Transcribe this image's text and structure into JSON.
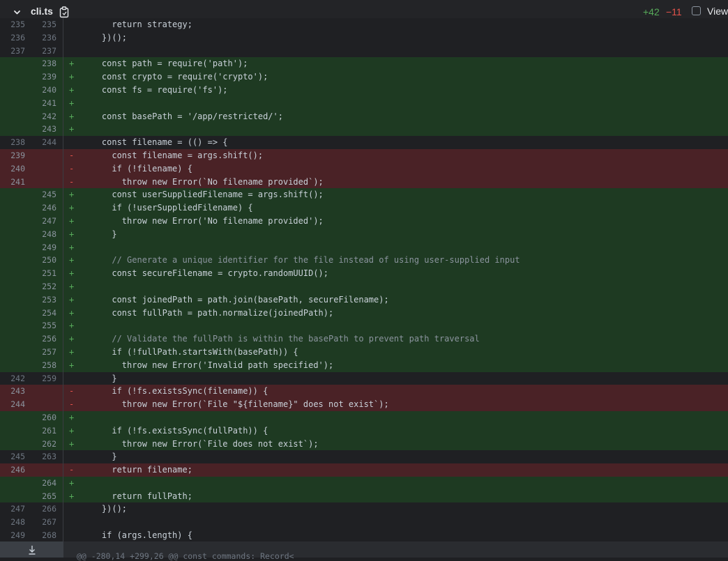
{
  "header": {
    "filename": "cli.ts",
    "additions": "+42",
    "deletions": "−11",
    "view_label": "View",
    "icons": [
      "chevron-down-icon",
      "copy-icon",
      "checkbox"
    ]
  },
  "colors": {
    "added_bg": "#1e3a22",
    "removed_bg": "#4a2226",
    "added_text": "#57ab5a",
    "removed_text": "#e5534b"
  },
  "lines": [
    {
      "type": "ctx",
      "old": "235",
      "new": "235",
      "code": "      return strategy;"
    },
    {
      "type": "ctx",
      "old": "236",
      "new": "236",
      "code": "    })();"
    },
    {
      "type": "ctx",
      "old": "237",
      "new": "237",
      "code": ""
    },
    {
      "type": "add",
      "old": "",
      "new": "238",
      "code": "    const path = require('path');"
    },
    {
      "type": "add",
      "old": "",
      "new": "239",
      "code": "    const crypto = require('crypto');"
    },
    {
      "type": "add",
      "old": "",
      "new": "240",
      "code": "    const fs = require('fs');"
    },
    {
      "type": "add",
      "old": "",
      "new": "241",
      "code": ""
    },
    {
      "type": "add",
      "old": "",
      "new": "242",
      "code": "    const basePath = '/app/restricted/';"
    },
    {
      "type": "add",
      "old": "",
      "new": "243",
      "code": ""
    },
    {
      "type": "ctx",
      "old": "238",
      "new": "244",
      "code": "    const filename = (() => {"
    },
    {
      "type": "del",
      "old": "239",
      "new": "",
      "code": "      const filename = args.shift();"
    },
    {
      "type": "del",
      "old": "240",
      "new": "",
      "code": "      if (!filename) {"
    },
    {
      "type": "del",
      "old": "241",
      "new": "",
      "code": "        throw new Error(`No filename provided`);"
    },
    {
      "type": "add",
      "old": "",
      "new": "245",
      "code": "      const userSuppliedFilename = args.shift();"
    },
    {
      "type": "add",
      "old": "",
      "new": "246",
      "code": "      if (!userSuppliedFilename) {"
    },
    {
      "type": "add",
      "old": "",
      "new": "247",
      "code": "        throw new Error('No filename provided');"
    },
    {
      "type": "add",
      "old": "",
      "new": "248",
      "code": "      }"
    },
    {
      "type": "add",
      "old": "",
      "new": "249",
      "code": ""
    },
    {
      "type": "add",
      "old": "",
      "new": "250",
      "code": "      // Generate a unique identifier for the file instead of using user-supplied input"
    },
    {
      "type": "add",
      "old": "",
      "new": "251",
      "code": "      const secureFilename = crypto.randomUUID();"
    },
    {
      "type": "add",
      "old": "",
      "new": "252",
      "code": ""
    },
    {
      "type": "add",
      "old": "",
      "new": "253",
      "code": "      const joinedPath = path.join(basePath, secureFilename);"
    },
    {
      "type": "add",
      "old": "",
      "new": "254",
      "code": "      const fullPath = path.normalize(joinedPath);"
    },
    {
      "type": "add",
      "old": "",
      "new": "255",
      "code": ""
    },
    {
      "type": "add",
      "old": "",
      "new": "256",
      "code": "      // Validate the fullPath is within the basePath to prevent path traversal"
    },
    {
      "type": "add",
      "old": "",
      "new": "257",
      "code": "      if (!fullPath.startsWith(basePath)) {"
    },
    {
      "type": "add",
      "old": "",
      "new": "258",
      "code": "        throw new Error('Invalid path specified');"
    },
    {
      "type": "ctx",
      "old": "242",
      "new": "259",
      "code": "      }"
    },
    {
      "type": "del",
      "old": "243",
      "new": "",
      "code": "      if (!fs.existsSync(filename)) {"
    },
    {
      "type": "del",
      "old": "244",
      "new": "",
      "code": "        throw new Error(`File \"${filename}\" does not exist`);"
    },
    {
      "type": "add",
      "old": "",
      "new": "260",
      "code": ""
    },
    {
      "type": "add",
      "old": "",
      "new": "261",
      "code": "      if (!fs.existsSync(fullPath)) {"
    },
    {
      "type": "add",
      "old": "",
      "new": "262",
      "code": "        throw new Error(`File does not exist`);"
    },
    {
      "type": "ctx",
      "old": "245",
      "new": "263",
      "code": "      }"
    },
    {
      "type": "del",
      "old": "246",
      "new": "",
      "code": "      return filename;"
    },
    {
      "type": "add",
      "old": "",
      "new": "264",
      "code": ""
    },
    {
      "type": "add",
      "old": "",
      "new": "265",
      "code": "      return fullPath;"
    },
    {
      "type": "ctx",
      "old": "247",
      "new": "266",
      "code": "    })();"
    },
    {
      "type": "ctx",
      "old": "248",
      "new": "267",
      "code": ""
    },
    {
      "type": "ctx",
      "old": "249",
      "new": "268",
      "code": "    if (args.length) {"
    }
  ],
  "footer": {
    "hunk_header": "@@ -280,14 +299,26 @@ const commands: Record<"
  }
}
